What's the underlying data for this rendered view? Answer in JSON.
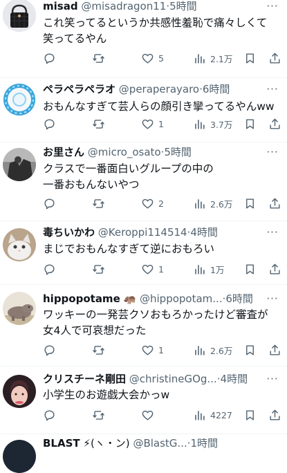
{
  "tweets": [
    {
      "name": "misad",
      "badge": "",
      "handle": "@misadragon11",
      "sep": "·",
      "time": "5時間",
      "text": [
        "これ笑ってるというか共感性羞恥で痛々しくて",
        "笑ってるやん"
      ],
      "likes": "5",
      "views": "2.1万",
      "retweets": ""
    },
    {
      "name": "ペラペラペラオ",
      "badge": "",
      "handle": "@peraperayaro",
      "sep": "·",
      "time": "6時間",
      "text": [
        "おもんなすぎて芸人らの顔引き攣ってるやんww"
      ],
      "likes": "1",
      "views": "3.7万",
      "retweets": ""
    },
    {
      "name": "お里さん",
      "badge": "",
      "handle": "@micro_osato",
      "sep": "·",
      "time": "5時間",
      "text": [
        "クラスで一番面白いグループの中の",
        "一番おもんないやつ"
      ],
      "likes": "2",
      "views": "2.6万",
      "retweets": ""
    },
    {
      "name": "毒ちいかわ",
      "badge": "",
      "handle": "@Keroppi114514",
      "sep": "·",
      "time": "4時間",
      "text": [
        "まじでおもんなすぎて逆におもろい"
      ],
      "likes": "1",
      "views": "1万",
      "retweets": ""
    },
    {
      "name": "hippopotame",
      "badge": "🦛",
      "handle": "@hippopotam...",
      "sep": "·",
      "time": "6時間",
      "text": [
        "ワッキーの一発芸クソおもろかったけど審査が",
        "女4人で可哀想だった"
      ],
      "likes": "1",
      "views": "2.6万",
      "retweets": ""
    },
    {
      "name": "クリスチーネ剛田",
      "badge": "",
      "handle": "@christineGOg...",
      "sep": "·",
      "time": "4時間",
      "text": [
        "小学生のお遊戯大会かっw"
      ],
      "likes": "",
      "views": "4227",
      "retweets": ""
    },
    {
      "name": "BLAST",
      "badge": "⚡(ヽ・ン)",
      "handle": "@BlastG...",
      "sep": "·",
      "time": "1時間",
      "text": [],
      "likes": "",
      "views": "",
      "retweets": ""
    }
  ],
  "icons": {
    "reply": "reply-icon",
    "retweet": "retweet-icon",
    "like": "heart-icon",
    "views": "views-icon",
    "bookmark": "bookmark-icon",
    "share": "share-icon",
    "more": "more-icon"
  },
  "colors": {
    "text": "#0f1419",
    "secondary": "#536471",
    "divider": "#eff3f4",
    "background": "#ffffff"
  }
}
